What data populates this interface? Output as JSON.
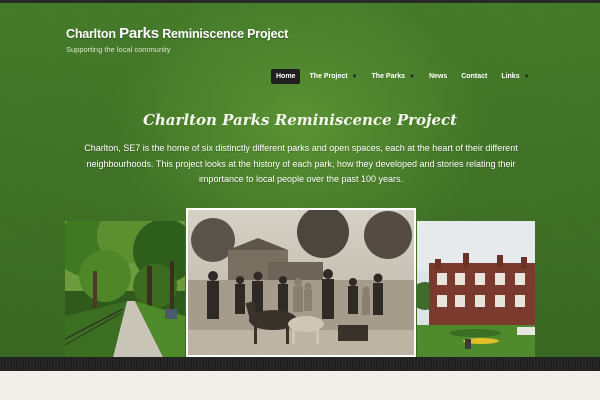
{
  "header": {
    "title_part1": "Charlton ",
    "title_part2": "Parks",
    "title_part3": " Reminiscence Project",
    "tagline": "Supporting the local community"
  },
  "nav": {
    "items": [
      {
        "label": "Home",
        "active": true,
        "dropdown": false
      },
      {
        "label": "The Project",
        "active": false,
        "dropdown": true
      },
      {
        "label": "The Parks",
        "active": false,
        "dropdown": true
      },
      {
        "label": "News",
        "active": false,
        "dropdown": false
      },
      {
        "label": "Contact",
        "active": false,
        "dropdown": false
      },
      {
        "label": "Links",
        "active": false,
        "dropdown": true
      }
    ],
    "dropdown_icon": "chevron-down-icon"
  },
  "hero": {
    "heading": "Charlton Parks Reminiscence Project",
    "text": "Charlton, SE7 is the home of six distinctly different parks and open spaces, each at the heart of their different neighbourhoods. This project looks at the history of each park, how they developed and stories relating their importance to local people over the past 100 years."
  },
  "photos": [
    {
      "subject": "tree-lined-path-photo"
    },
    {
      "subject": "historic-group-photo"
    },
    {
      "subject": "charlton-house-photo"
    }
  ],
  "colors": {
    "hero_green": "#3f7126",
    "nav_active": "#1f1f1f",
    "footer_stripe": "#1f1f1f",
    "page_background": "#f1efe9"
  }
}
